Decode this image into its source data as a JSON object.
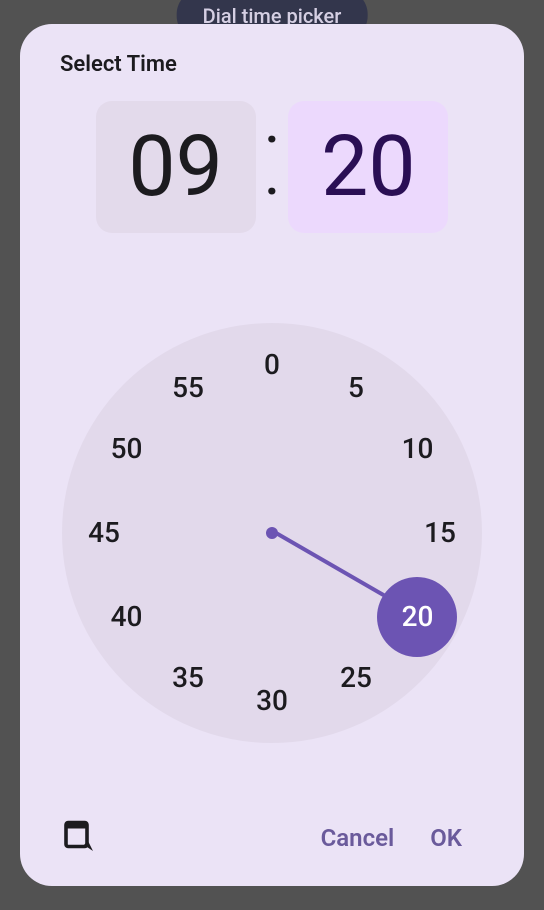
{
  "backdrop": {
    "button_label": "Dial time picker"
  },
  "title": "Select Time",
  "hours": "09",
  "minutes": "20",
  "active_field": "minutes",
  "selected_minute": 20,
  "clock_numbers": [
    0,
    5,
    10,
    15,
    20,
    25,
    30,
    35,
    40,
    45,
    50,
    55
  ],
  "actions": {
    "cancel": "Cancel",
    "ok": "OK"
  },
  "colors": {
    "dialog_bg": "#ebe3f6",
    "accent": "#6c54b3",
    "minute_box_bg": "#ecd9fd"
  }
}
